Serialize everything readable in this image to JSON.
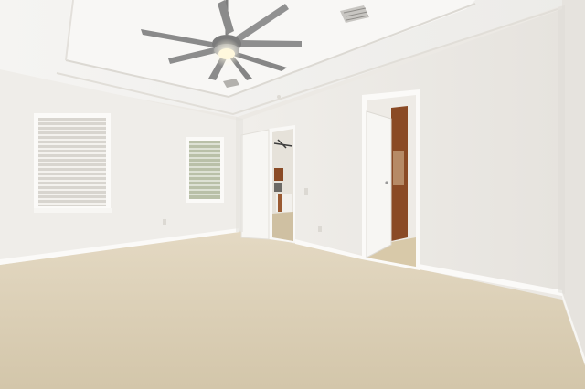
{
  "scene": {
    "subject": "empty-bedroom",
    "colors": {
      "wall": "#f1efeb",
      "wall_shadow": "#e2dfda",
      "ceiling": "#f3f2ef",
      "carpet": "#d9cdb3",
      "trim": "#fbfaf8",
      "door": "#f7f6f3",
      "wood_cabinet": "#8a4a25",
      "hallway_floor": "#d8c9a9",
      "fan_metal": "#8b8b8b",
      "light": "#fff8dd"
    },
    "icons": [
      "ceiling-fan-icon",
      "air-vent-icon",
      "window-blinds-icon",
      "electrical-outlet-icon"
    ]
  }
}
